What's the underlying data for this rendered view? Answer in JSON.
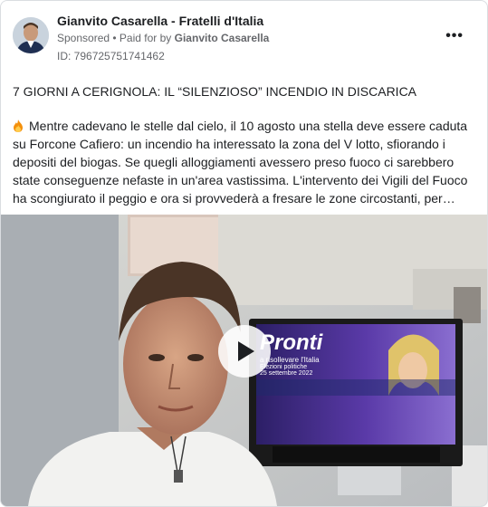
{
  "post": {
    "page_name": "Gianvito Casarella - Fratelli d'Italia",
    "sponsored_label": "Sponsored",
    "paid_for_prefix": "Paid for by",
    "paid_for_name": "Gianvito Casarella",
    "ad_id": "ID: 796725751741462",
    "more_label": "•••",
    "headline": "7 GIORNI A CERIGNOLA: IL “SILENZIOSO” INCENDIO IN DISCARICA",
    "body": "Mentre cadevano le stelle dal cielo, il 10 agosto una stella deve essere caduta su Forcone Cafiero: un incendio ha interessato la zona del V lotto, sfiorando i depositi del biogas. Se quegli alloggiamenti avessero preso fuoco ci sarebbero state conseguenze nefaste in un'area vastissima. L'intervento dei Vigili del Fuoco ha scongiurato il peggio e ora si provvederà a fresare le zone circostanti, per…",
    "body_icon": "fire-emoji-icon"
  },
  "video": {
    "tv_title": "Pronti",
    "tv_subtitle_1": "a risollevare l'Italia",
    "tv_subtitle_2": "Elezioni politiche",
    "tv_subtitle_3": "25 settembre 2022",
    "play_icon": "play-icon"
  },
  "colors": {
    "text": "#1c1e21",
    "secondary": "#65676b",
    "tv_screen": "#3a2a7a"
  }
}
